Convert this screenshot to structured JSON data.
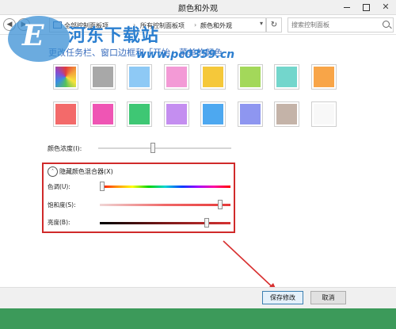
{
  "window": {
    "title": "颜色和外观",
    "controls": {
      "minimize": "",
      "maximize": "",
      "close": "✕"
    }
  },
  "navbar": {
    "back": "◀",
    "forward": "▶",
    "breadcrumb": [
      "全部控制面板项",
      "所有控制面板项",
      "颜色和外观"
    ],
    "separator": "›",
    "dropdown": "▾",
    "refresh": "↻",
    "search_placeholder": "搜索控制面板"
  },
  "watermark": {
    "logo_letter": "E",
    "title": "河东下载站",
    "url": "www.pc0359.cn"
  },
  "heading": "更改任务栏、窗口边框和「开始」菜单的颜色",
  "swatches": [
    {
      "name": "automatic",
      "color": "#ffffff",
      "icon": "color-wheel-icon"
    },
    {
      "name": "gray",
      "color": "#a8a8a8"
    },
    {
      "name": "light-blue",
      "color": "#8ec9f5"
    },
    {
      "name": "pink",
      "color": "#f39ad6"
    },
    {
      "name": "yellow",
      "color": "#f5c83a"
    },
    {
      "name": "green",
      "color": "#a3d85a"
    },
    {
      "name": "teal",
      "color": "#73d6cc"
    },
    {
      "name": "orange",
      "color": "#f8a548"
    },
    {
      "name": "red",
      "color": "#f36a6a"
    },
    {
      "name": "magenta",
      "color": "#ef55b4"
    },
    {
      "name": "emerald",
      "color": "#3ec774"
    },
    {
      "name": "violet",
      "color": "#c48ef0"
    },
    {
      "name": "blue",
      "color": "#4da8f0"
    },
    {
      "name": "periwinkle",
      "color": "#8e96f0"
    },
    {
      "name": "taupe",
      "color": "#c4b3a8"
    },
    {
      "name": "white",
      "color": "#f8f8f8"
    }
  ],
  "intensity": {
    "label": "颜色浓度(I):",
    "value": 0.41
  },
  "mixer": {
    "toggle": "˄",
    "label": "隐藏颜色混合器(X)",
    "hue": {
      "label": "色调(U):",
      "value": 0.02
    },
    "saturation": {
      "label": "饱和度(S):",
      "value": 0.92
    },
    "brightness": {
      "label": "亮度(B):",
      "value": 0.82
    }
  },
  "footer": {
    "save_label": "保存修改",
    "cancel_label": "取消"
  },
  "accent_colors": {
    "highlight_box": "#d02a2a",
    "heading": "#3a6dbd",
    "watermark": "#2b7fd0",
    "background": "#3c9a5a"
  }
}
